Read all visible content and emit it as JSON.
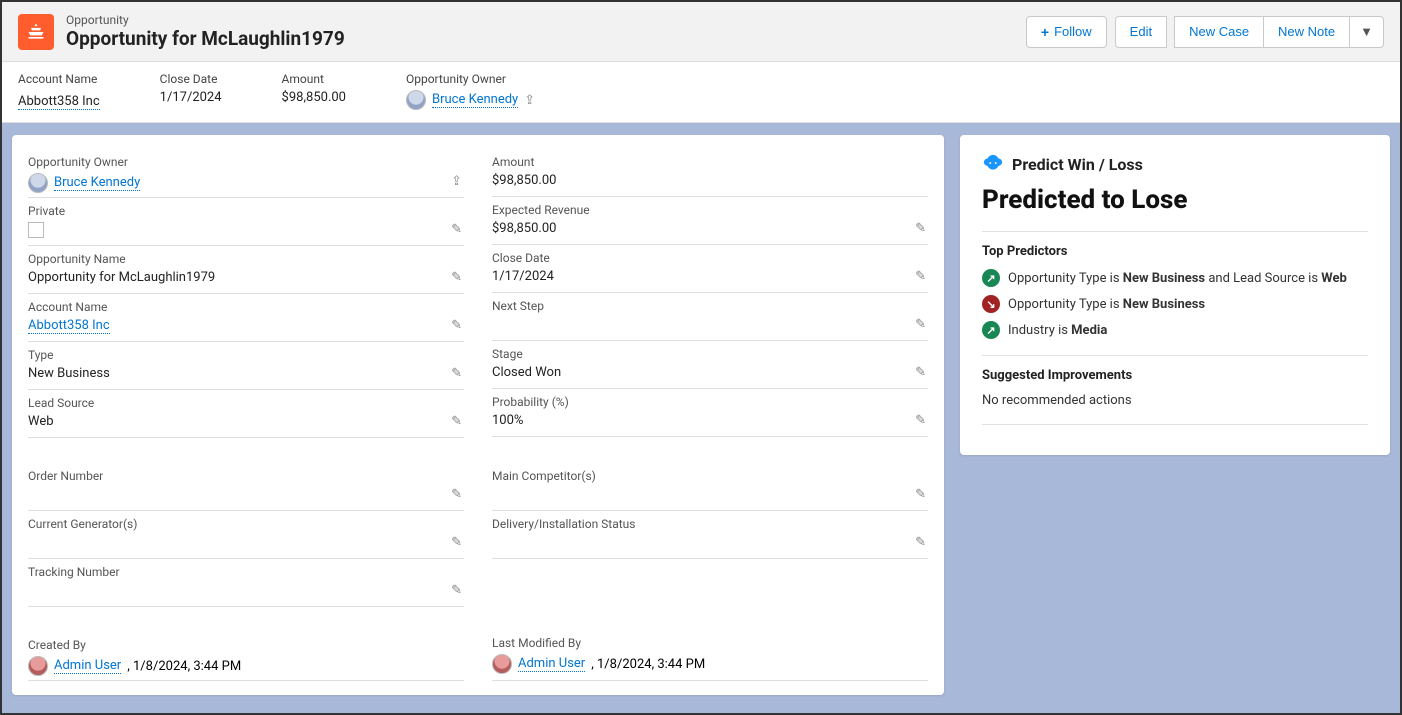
{
  "header": {
    "type_label": "Opportunity",
    "title": "Opportunity for McLaughlin1979",
    "actions": {
      "follow": "Follow",
      "edit": "Edit",
      "new_case": "New Case",
      "new_note": "New Note"
    }
  },
  "summary": {
    "account_name_label": "Account Name",
    "account_name": "Abbott358 Inc",
    "close_date_label": "Close Date",
    "close_date": "1/17/2024",
    "amount_label": "Amount",
    "amount": "$98,850.00",
    "owner_label": "Opportunity Owner",
    "owner": "Bruce Kennedy"
  },
  "detail_left": {
    "owner_label": "Opportunity Owner",
    "owner": "Bruce Kennedy",
    "private_label": "Private",
    "opp_name_label": "Opportunity Name",
    "opp_name": "Opportunity for McLaughlin1979",
    "account_label": "Account Name",
    "account": "Abbott358 Inc",
    "type_label": "Type",
    "type": "New Business",
    "lead_source_label": "Lead Source",
    "lead_source": "Web",
    "order_number_label": "Order Number",
    "order_number": "",
    "current_gen_label": "Current Generator(s)",
    "current_gen": "",
    "tracking_label": "Tracking Number",
    "tracking": "",
    "created_by_label": "Created By",
    "created_by_user": "Admin User",
    "created_by_date": ", 1/8/2024, 3:44 PM"
  },
  "detail_right": {
    "amount_label": "Amount",
    "amount": "$98,850.00",
    "expected_rev_label": "Expected Revenue",
    "expected_rev": "$98,850.00",
    "close_date_label": "Close Date",
    "close_date": "1/17/2024",
    "next_step_label": "Next Step",
    "next_step": "",
    "stage_label": "Stage",
    "stage": "Closed Won",
    "probability_label": "Probability (%)",
    "probability": "100%",
    "main_competitor_label": "Main Competitor(s)",
    "main_competitor": "",
    "delivery_label": "Delivery/Installation Status",
    "delivery": "",
    "last_mod_label": "Last Modified By",
    "last_mod_user": "Admin User",
    "last_mod_date": ", 1/8/2024, 3:44 PM"
  },
  "predict": {
    "panel_title": "Predict Win / Loss",
    "verdict": "Predicted to Lose",
    "top_predictors_label": "Top Predictors",
    "predictors": [
      {
        "dir": "up",
        "pre": "Opportunity Type is ",
        "b1": "New Business",
        "mid": " and Lead Source is ",
        "b2": "Web"
      },
      {
        "dir": "down",
        "pre": "Opportunity Type is ",
        "b1": "New Business",
        "mid": "",
        "b2": ""
      },
      {
        "dir": "up",
        "pre": "Industry is ",
        "b1": "Media",
        "mid": "",
        "b2": ""
      }
    ],
    "suggested_label": "Suggested Improvements",
    "suggested_text": "No recommended actions"
  }
}
